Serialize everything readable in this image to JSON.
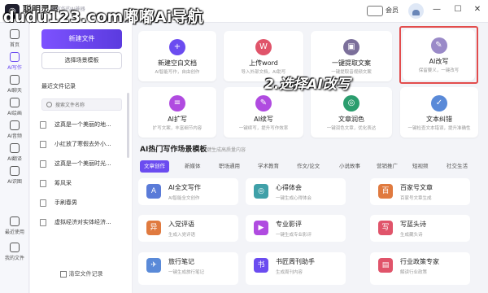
{
  "titlebar": {
    "brand": "聪明灵犀",
    "slogan": "AI写作的AI神器",
    "watermark": "dudu123.com嘟嘟Ai导航",
    "vip_label": "会员",
    "minimize": "—",
    "maximize": "☐",
    "close": "✕"
  },
  "sidebar": {
    "items": [
      {
        "label": "首页"
      },
      {
        "label": "AI写作"
      },
      {
        "label": "AI聊天"
      },
      {
        "label": "AI绘画"
      },
      {
        "label": "AI音频"
      },
      {
        "label": "AI翻译"
      },
      {
        "label": "AI识图"
      },
      {
        "label": "最近使用"
      },
      {
        "label": "我的文件"
      }
    ]
  },
  "panel": {
    "new_button": "新建文件",
    "template_button": "选择场景模板",
    "recent_title": "最近文件记录",
    "search_placeholder": "搜索文件名称",
    "files": [
      "这真是一个美丽的地...",
      "小红放了寒假去外小...",
      "这真是一个美丽时光...",
      "筹风采",
      "手刷春男",
      "虚拟经济对实体经济..."
    ],
    "clear_label": "清空文件记录"
  },
  "cards": [
    {
      "title": "新建空白文档",
      "desc": "AI智能写作，自由创作",
      "icon": "+",
      "color": "#6b4cf0"
    },
    {
      "title": "上传word",
      "desc": "导入外部文档，AI助写",
      "icon": "W",
      "color": "#e0546a"
    },
    {
      "title": "一键提取文案",
      "desc": "一键提取音视频文案",
      "icon": "▣",
      "color": "#7b6f9a"
    },
    {
      "title": "AI改写",
      "desc": "保留要义，一键改写",
      "icon": "✎",
      "color": "#9a8ac8"
    },
    {
      "title": "AI扩写",
      "desc": "扩写文案，丰富细节内容",
      "icon": "≡",
      "color": "#b04be0"
    },
    {
      "title": "AI续写",
      "desc": "一键续写，提升写作效率",
      "icon": "✎",
      "color": "#b04be0"
    },
    {
      "title": "文章润色",
      "desc": "一键润色文章，优化表达",
      "icon": "◎",
      "color": "#2b9d6e"
    },
    {
      "title": "文本纠错",
      "desc": "一键检查文本错误，提升准确性",
      "icon": "✓",
      "color": "#5a8ad8"
    }
  ],
  "annotation": "2.选择AI改写",
  "section": {
    "title": "AI热门写作场景模板",
    "subtitle": "一键生成高质量内容"
  },
  "tabs": [
    "文章创作",
    "新媒体",
    "职场通用",
    "学术教育",
    "作文/论文",
    "小说故事",
    "营销推广",
    "短视频",
    "社交生活"
  ],
  "templates": [
    {
      "title": "AI全文写作",
      "desc": "AI智能全文创作",
      "icon": "A",
      "color": "#5a7bd8"
    },
    {
      "title": "心得体会",
      "desc": "一键生成心得体会",
      "icon": "◎",
      "color": "#3fa0a8"
    },
    {
      "title": "百家号文章",
      "desc": "百家号文章生成",
      "icon": "百",
      "color": "#e07a3f"
    },
    {
      "title": "入党评语",
      "desc": "生成入党评语",
      "icon": "异",
      "color": "#e07a3f"
    },
    {
      "title": "专业影评",
      "desc": "一键生成专业影评",
      "icon": "▶",
      "color": "#b04be0"
    },
    {
      "title": "写蓝头诗",
      "desc": "生成藏头诗",
      "icon": "写",
      "color": "#e0546a"
    },
    {
      "title": "旅行笔记",
      "desc": "一键生成旅行笔记",
      "icon": "✈",
      "color": "#5a8ad8"
    },
    {
      "title": "书匠周刊助手",
      "desc": "生成周刊内容",
      "icon": "书",
      "color": "#6b4cf0"
    },
    {
      "title": "行业政策专家",
      "desc": "解读行业政策",
      "icon": "▤",
      "color": "#e0546a"
    }
  ]
}
